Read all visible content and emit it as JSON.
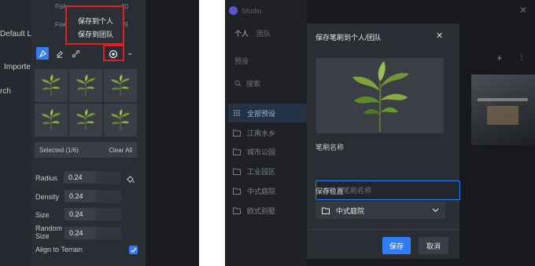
{
  "left_panel": {
    "side_labels": [
      "Default La",
      "Importe",
      "rch"
    ],
    "top_labels": [
      {
        "text": "Fish",
        "value": "20"
      },
      {
        "text": "Fow",
        "value": "9"
      }
    ],
    "popup_menu": [
      "保存到个人",
      "保存到团队"
    ],
    "selection": {
      "text": "Selected (1/6)",
      "clear": "Clear All"
    },
    "properties": [
      {
        "label": "Radius",
        "value": "0.24"
      },
      {
        "label": "Density",
        "value": "0.24"
      },
      {
        "label": "Size",
        "value": "0.24"
      },
      {
        "label": "Random Size",
        "value": "0.24"
      }
    ],
    "align_label": "Align to Terrain",
    "align_checked": true,
    "accent": "#2f7cf6",
    "highlight": "#e02020"
  },
  "right_panel": {
    "logo_text": "Studio",
    "tabs": [
      "个人",
      "团队"
    ],
    "preset_label": "预设",
    "search_placeholder": "搜索",
    "nav_items": [
      "全部预设",
      "江南水乡",
      "城市公园",
      "工业园区",
      "中式庭院",
      "欧式别墅"
    ],
    "dialog": {
      "title": "保存笔刷到个人/团队",
      "name_label": "笔刷名称",
      "name_placeholder": "请输入笔刷名称",
      "location_label": "保存位置",
      "location_value": "中式庭院",
      "save": "保存",
      "cancel": "取消"
    }
  }
}
